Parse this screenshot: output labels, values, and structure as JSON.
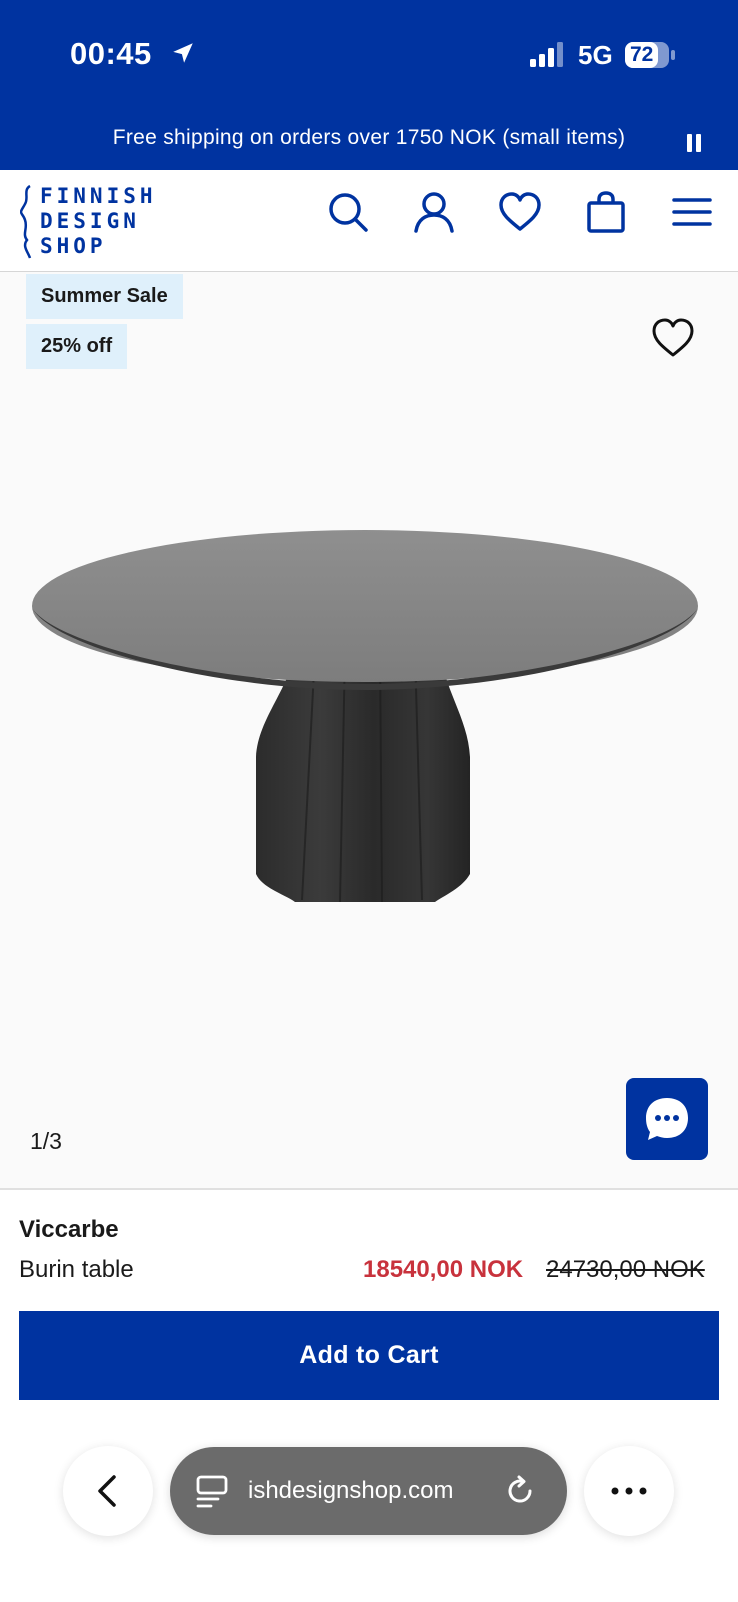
{
  "status_bar": {
    "time": "00:45",
    "network": "5G",
    "battery": "72"
  },
  "promo": {
    "text": "Free shipping on orders over 1750 NOK (small items)"
  },
  "header": {
    "logo_lines": [
      "FINNISH",
      "DESIGN",
      "SHOP"
    ],
    "icons": [
      "search-icon",
      "account-icon",
      "wishlist-icon",
      "bag-icon",
      "menu-icon"
    ]
  },
  "product_image": {
    "badges": [
      "Summer Sale",
      "25% off"
    ],
    "counter": "1/3"
  },
  "product": {
    "brand": "Viccarbe",
    "name": "Burin table",
    "sale_price": "18540,00 NOK",
    "original_price": "24730,00 NOK",
    "add_to_cart": "Add to Cart"
  },
  "browser": {
    "url": "ishdesignshop.com"
  },
  "colors": {
    "brand_blue": "#0033a0",
    "sale_red": "#c8323c",
    "badge_bg": "#dff0fb"
  }
}
